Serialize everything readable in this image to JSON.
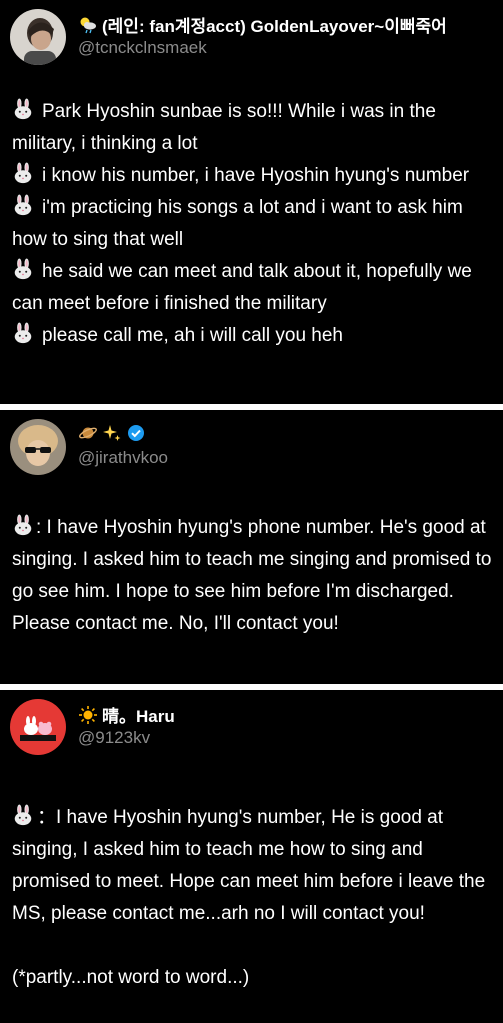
{
  "posts": [
    {
      "display_name": "(레인: fan계정acct) GoldenLayover~이뻐죽어",
      "handle": "@tcnckclnsmaek",
      "lines": [
        "Park Hyoshin sunbae is so!!! While i was in the military, i thinking a lot",
        "i know his number, i have Hyoshin hyung's number",
        "i'm practicing his songs a lot and i want to ask him how to sing that well",
        "he said we can meet and talk about it, hopefully we can meet before i finished the military",
        "please call me, ah i will call you heh"
      ]
    },
    {
      "display_name": "",
      "handle": "@jirathvkoo",
      "body_prefix": ": I have Hyoshin hyung's phone number. He's good at singing. I asked him to teach me singing and promised to go see him. I hope to see him before I'm discharged. Please contact me. No, I'll contact you!"
    },
    {
      "display_name": "晴。Haru",
      "handle": "@9123kv",
      "body": "：I have Hyoshin hyung's number, He is good at singing, I asked him to teach me how to sing and promised to meet. Hope can meet him before i leave the MS, please contact me...arh no I will contact you!",
      "note": "(*partly...not word to word...)"
    }
  ],
  "icons": {
    "weather": "sun-behind-rain-cloud-icon",
    "bunny": "rabbit-face-icon",
    "planet": "ringed-planet-icon",
    "sparkles": "sparkles-icon",
    "verified": "verified-badge-icon",
    "sun": "sun-icon"
  },
  "colors": {
    "card_bg": "#000000",
    "text": "#ffffff",
    "handle": "#8b8b8b",
    "verified": "#1d9bf0",
    "avatar3_bg": "#e53935"
  }
}
